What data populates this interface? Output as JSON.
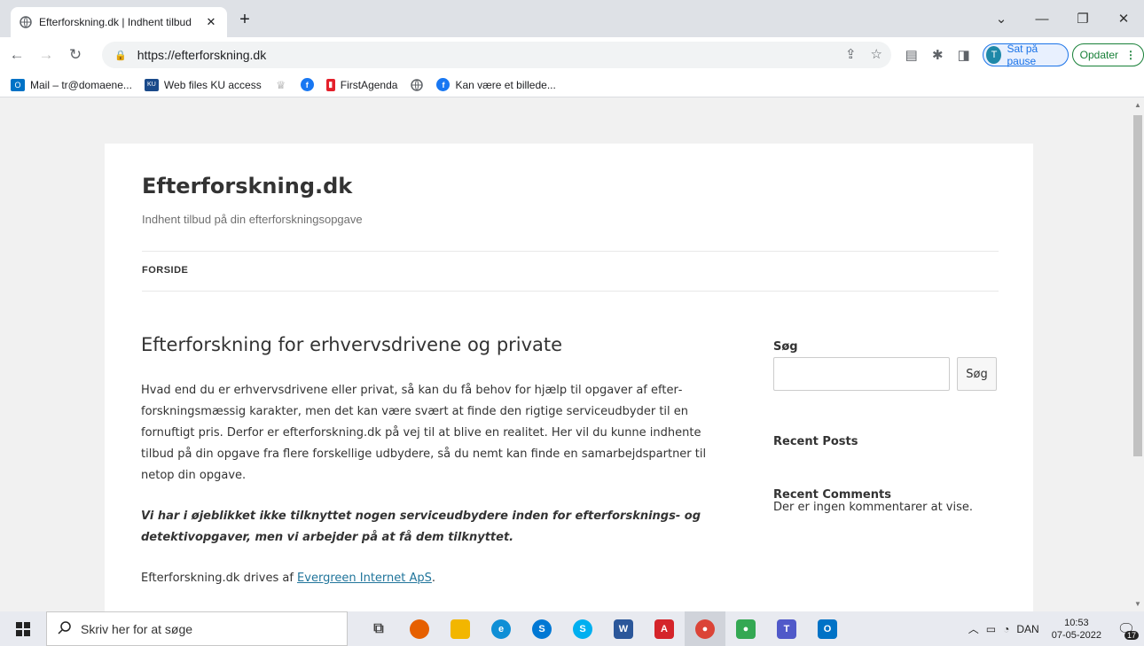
{
  "browser": {
    "tab_title": "Efterforskning.dk | Indhent tilbud",
    "url": "https://efterforskning.dk",
    "profile_initial": "T",
    "profile_label": "Sat på pause",
    "update_label": "Opdater",
    "bookmarks": [
      {
        "label": "Mail – tr@domaene...",
        "icon": "outlook-icon",
        "color": "#0072c6"
      },
      {
        "label": "Web files KU access",
        "icon": "ku-icon",
        "color": "#1a4a8a"
      },
      {
        "label": "",
        "icon": "crest-icon",
        "color": "#888888"
      },
      {
        "label": "",
        "icon": "facebook-icon",
        "color": "#1877f2"
      },
      {
        "label": "FirstAgenda",
        "icon": "firstagenda-icon",
        "color": "#e4202b"
      },
      {
        "label": "",
        "icon": "globe-icon",
        "color": "#5f6368"
      },
      {
        "label": "Kan være et billede...",
        "icon": "facebook-icon",
        "color": "#1877f2"
      }
    ]
  },
  "site": {
    "title": "Efterforskning.dk",
    "description": "Indhent tilbud på din efterforskningsopgave",
    "menu_home": "FORSIDE"
  },
  "post": {
    "title": "Efterforskning for erhvervsdrivene og private",
    "paragraph1": "Hvad end du er erhvervsdrivene eller privat, så kan du få behov for hjælp til opgaver af efter­forskningsmæssig karakter, men det kan være svært at finde den rigtige serviceudbyder til en fornuftigt pris. Derfor er efterforskning.dk på vej til at blive en realitet. Her vil du kunne ind­hente tilbud på din opgave fra flere forskellige udbydere, så du nemt kan finde en samarbejds­partner til netop din opgave.",
    "notice": "Vi har i øjeblikket ikke tilknyttet nogen serviceudbydere inden for efterforsknings- og detekti­vopgaver, men vi arbejder på at få dem tilknyttet.",
    "footer_prefix": "Efterforskning.dk drives af ",
    "footer_link": "Evergreen Internet ApS",
    "footer_suffix": "."
  },
  "sidebar": {
    "search_title": "Søg",
    "search_button": "Søg",
    "search_value": "",
    "recent_posts_title": "Recent Posts",
    "recent_comments_title": "Recent Comments",
    "no_comments": "Der er ingen kommentarer at vise."
  },
  "taskbar": {
    "search_placeholder": "Skriv her for at søge",
    "language": "DAN",
    "time": "10:53",
    "date": "07-05-2022",
    "notification_count": "17",
    "apps": [
      {
        "name": "task-view-icon",
        "color": "#444444",
        "glyph": "⧉"
      },
      {
        "name": "firefox-icon",
        "color": "#e66000",
        "glyph": ""
      },
      {
        "name": "file-explorer-icon",
        "color": "#f2b600",
        "glyph": ""
      },
      {
        "name": "edge-icon",
        "color": "#0f8fd6",
        "glyph": "e"
      },
      {
        "name": "skype-business-icon",
        "color": "#0078d4",
        "glyph": "S"
      },
      {
        "name": "skype-icon",
        "color": "#00aff0",
        "glyph": "S"
      },
      {
        "name": "word-icon",
        "color": "#2b579a",
        "glyph": "W"
      },
      {
        "name": "acrobat-icon",
        "color": "#d4242a",
        "glyph": "A"
      },
      {
        "name": "chrome-icon",
        "color": "#db4437",
        "glyph": "●"
      },
      {
        "name": "chromium-icon",
        "color": "#34a853",
        "glyph": "●"
      },
      {
        "name": "teams-icon",
        "color": "#5059c9",
        "glyph": "T"
      },
      {
        "name": "outlook-icon",
        "color": "#0072c6",
        "glyph": "O"
      }
    ]
  }
}
